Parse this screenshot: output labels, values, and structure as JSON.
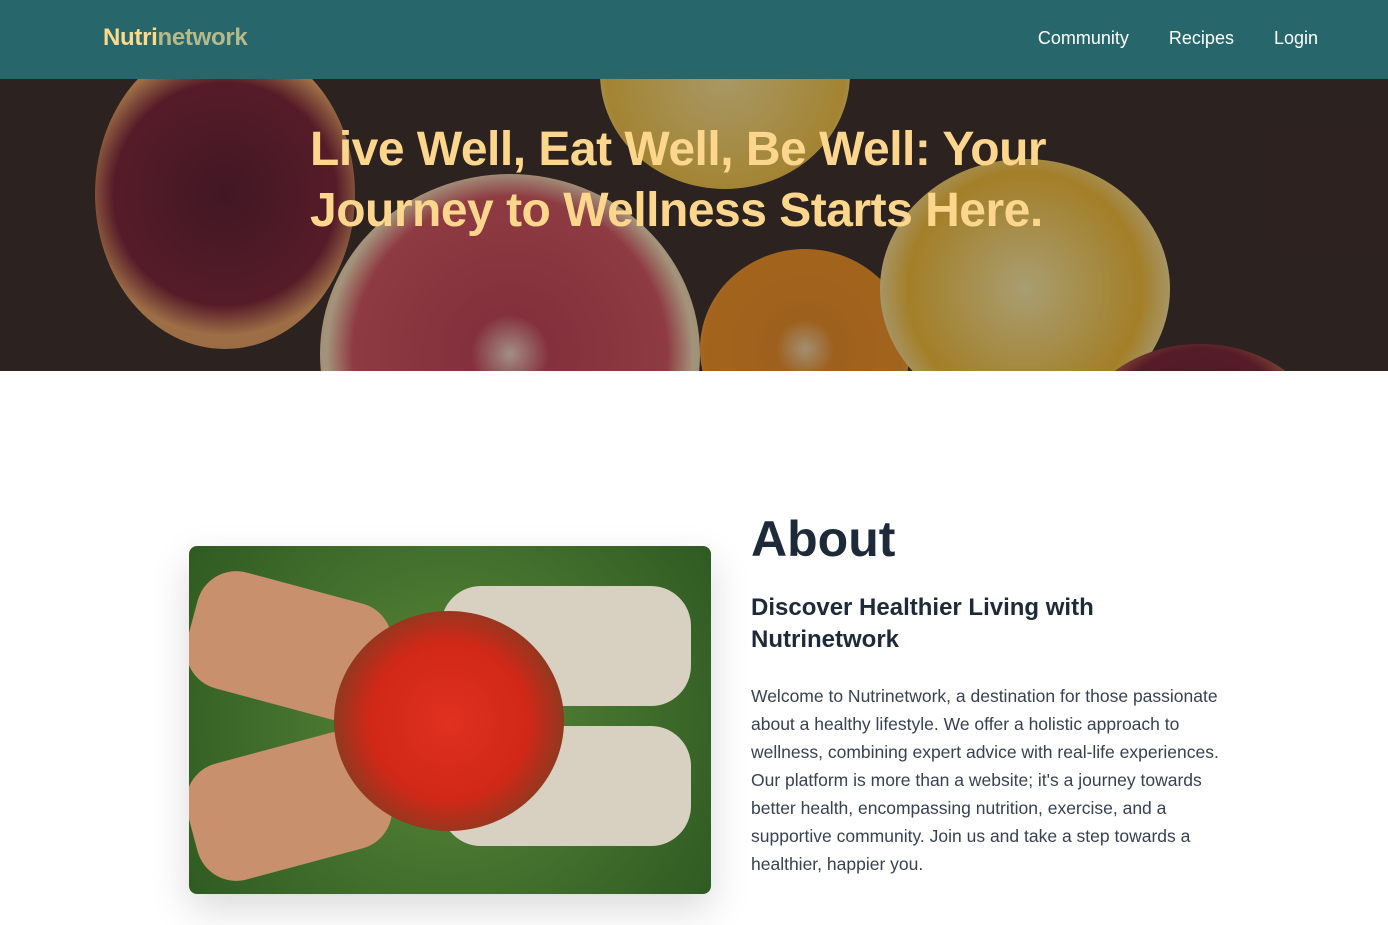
{
  "nav": {
    "logo_part1": "Nutri",
    "logo_part2": "network",
    "links": [
      "Community",
      "Recipes",
      "Login"
    ]
  },
  "hero": {
    "title": "Live Well, Eat Well, Be Well: Your Journey to Wellness Starts Here."
  },
  "about": {
    "heading": "About",
    "subheading": "Discover Healthier Living with Nutrinetwork",
    "body": "Welcome to Nutrinetwork, a destination for those passionate about a healthy lifestyle. We offer a holistic approach to wellness, combining expert advice with real-life experiences. Our platform is more than a website; it's a journey towards better health, encompassing nutrition, exercise, and a supportive community. Join us and take a step towards a healthier, happier you."
  },
  "colors": {
    "header": "#27676c",
    "accent": "#fdd98b"
  }
}
